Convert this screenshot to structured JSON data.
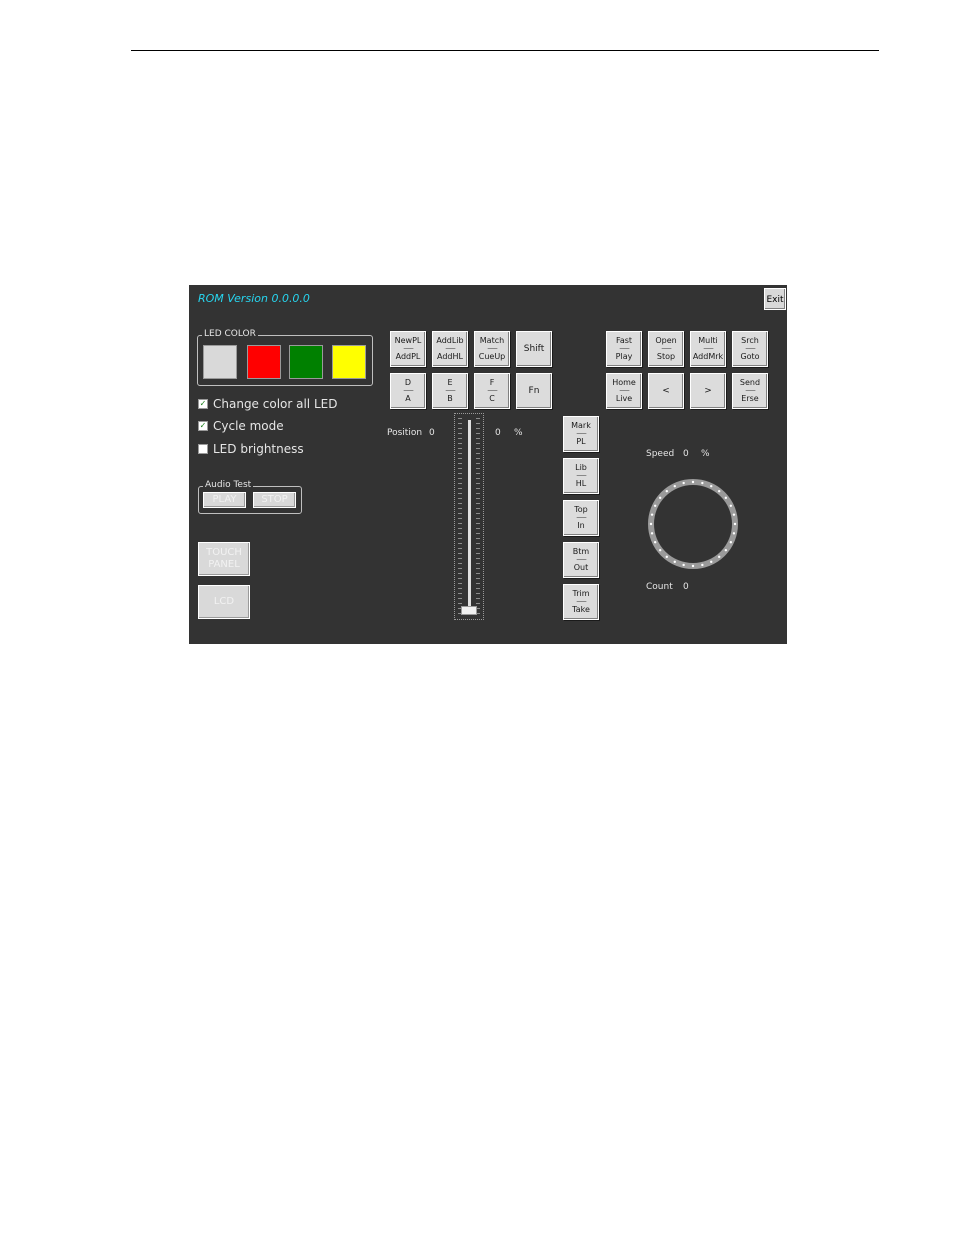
{
  "rom_version": "ROM Version 0.0.0.0",
  "exit_label": "Exit",
  "led_color": {
    "title": "LED COLOR",
    "swatches": [
      "#d9d9d9",
      "#ff0000",
      "#008000",
      "#ffff00"
    ]
  },
  "checkboxes": [
    {
      "label": "Change color all LED",
      "checked": true
    },
    {
      "label": "Cycle mode",
      "checked": true
    },
    {
      "label": "LED brightness",
      "checked": false
    }
  ],
  "audio_test": {
    "title": "Audio Test",
    "play_label": "PLAY",
    "stop_label": "STOP"
  },
  "touch_panel_label": "TOUCH PANEL",
  "lcd_label": "LCD",
  "keys_left": [
    {
      "top": "NewPL",
      "bot": "AddPL"
    },
    {
      "top": "AddLib",
      "bot": "AddHL"
    },
    {
      "top": "Match",
      "bot": "CueUp"
    },
    {
      "single": "Shift"
    },
    {
      "top": "D",
      "bot": "A"
    },
    {
      "top": "E",
      "bot": "B"
    },
    {
      "top": "F",
      "bot": "C"
    },
    {
      "single": "Fn"
    }
  ],
  "keys_right": [
    {
      "top": "Fast",
      "bot": "Play"
    },
    {
      "top": "Open",
      "bot": "Stop"
    },
    {
      "top": "Multi",
      "bot": "AddMrk"
    },
    {
      "top": "Srch",
      "bot": "Goto"
    },
    {
      "top": "Home",
      "bot": "Live"
    },
    {
      "single": "<"
    },
    {
      "single": ">"
    },
    {
      "top": "Send",
      "bot": "Erse"
    }
  ],
  "keys_column": [
    {
      "top": "Mark",
      "bot": "PL"
    },
    {
      "top": "Lib",
      "bot": "HL"
    },
    {
      "top": "Top",
      "bot": "In"
    },
    {
      "top": "Btm",
      "bot": "Out"
    },
    {
      "top": "Trim",
      "bot": "Take"
    }
  ],
  "separator_text": "--------",
  "position": {
    "label": "Position",
    "value": "0",
    "percent_value": "0",
    "percent_sign": "%"
  },
  "speed": {
    "label": "Speed",
    "value": "0",
    "percent_sign": "%"
  },
  "count": {
    "label": "Count",
    "value": "0"
  },
  "fader_level": 0
}
